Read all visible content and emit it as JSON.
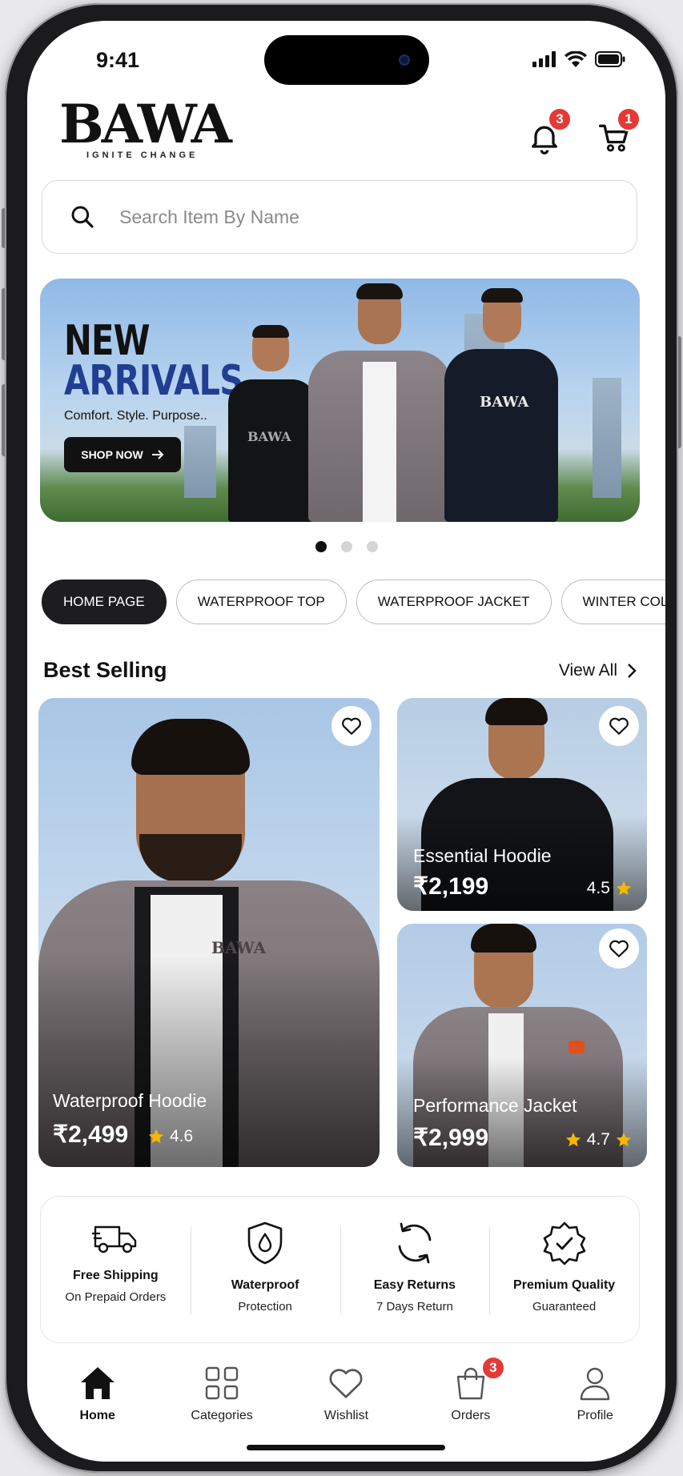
{
  "status": {
    "time": "9:41"
  },
  "brand": {
    "name": "BAWA",
    "tagline": "IGNITE CHANGE"
  },
  "header": {
    "notifications_badge": "3",
    "cart_badge": "1"
  },
  "search": {
    "placeholder": "Search Item By Name"
  },
  "banner": {
    "title_line1": "NEW",
    "title_line2": "ARRIVALS",
    "tagline": "Comfort. Style. Purpose..",
    "cta": "SHOP NOW",
    "shirt_print": "BAWA",
    "slides": 3,
    "active_slide": 1
  },
  "categories": [
    "HOME PAGE",
    "WATERPROOF TOP",
    "WATERPROOF JACKET",
    "WINTER COLLECTION"
  ],
  "best_selling": {
    "title": "Best Selling",
    "view_all": "View All",
    "products": [
      {
        "name": "Waterproof Hoodie",
        "price": "₹2,499",
        "rating": "4.6"
      },
      {
        "name": "Essential Hoodie",
        "price": "₹2,199",
        "rating": "4.5"
      },
      {
        "name": "Performance Jacket",
        "price": "₹2,999",
        "rating": "4.7"
      }
    ]
  },
  "features": [
    {
      "icon": "truck-icon",
      "title": "Free Shipping",
      "subtitle": "On Prepaid Orders"
    },
    {
      "icon": "shield-drop-icon",
      "title": "Waterproof",
      "subtitle": "Protection"
    },
    {
      "icon": "refresh-icon",
      "title": "Easy Returns",
      "subtitle": "7 Days Return"
    },
    {
      "icon": "badge-check-icon",
      "title": "Premium Quality",
      "subtitle": "Guaranteed"
    }
  ],
  "nav": {
    "items": [
      "Home",
      "Categories",
      "Wishlist",
      "Orders",
      "Profile"
    ],
    "active": "Home",
    "orders_badge": "3"
  },
  "colors": {
    "accent": "#223e92",
    "badge": "#e53935",
    "star": "#f5b800",
    "dark": "#1d1d1f"
  }
}
